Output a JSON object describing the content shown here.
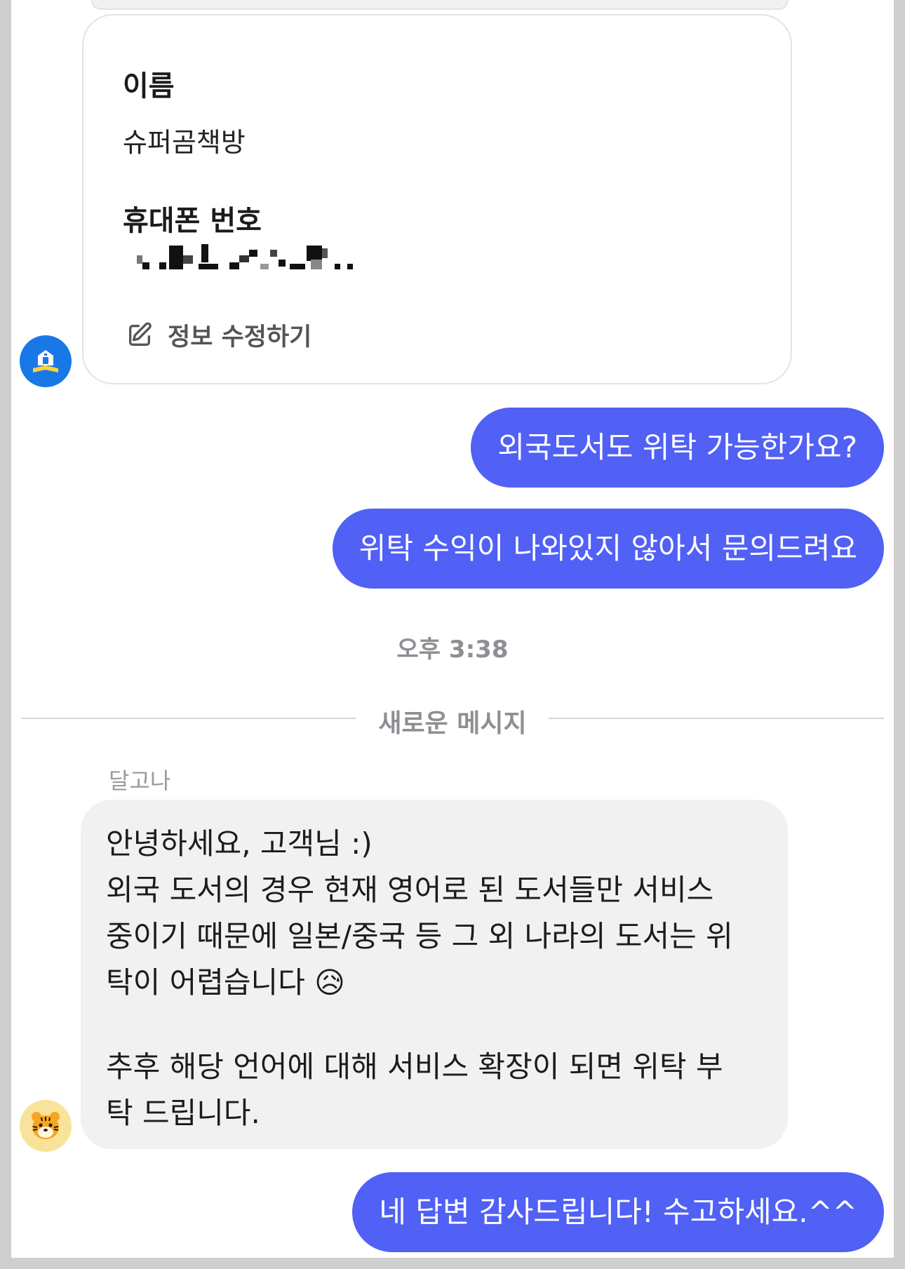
{
  "info_card": {
    "name_label": "이름",
    "name_value": "슈퍼곰책방",
    "phone_label": "휴대폰 번호",
    "edit_label": "정보 수정하기",
    "edit_icon": "edit-pencil-icon"
  },
  "messages_out_1": "외국도서도 위탁 가능한가요?",
  "messages_out_2": "위탁 수익이 나와있지 않아서 문의드려요",
  "timestamp": "오후 3:38",
  "new_messages_divider": "새로운 메시지",
  "agent": {
    "name": "달고나",
    "avatar_icon": "tiger-face-icon",
    "message_lines": [
      "안녕하세요, 고객님 :)",
      "외국 도서의 경우 현재 영어로 된 도서들만 서비스",
      "중이기 때문에 일본/중국 등 그 외 나라의 도서는 위",
      "탁이 어렵습니다 😥",
      "추후 해당 언어에 대해 서비스 확장이 되면 위탁 부",
      "탁 드립니다."
    ]
  },
  "messages_out_3": "네 답변 감사드립니다! 수고하세요.^^",
  "bot_avatar_icon": "bookstore-icon",
  "colors": {
    "outgoing_bubble": "#5160f5",
    "incoming_bubble": "#f1f1f2",
    "bot_avatar": "#1878e8",
    "tiger_avatar": "#f8e39a"
  }
}
